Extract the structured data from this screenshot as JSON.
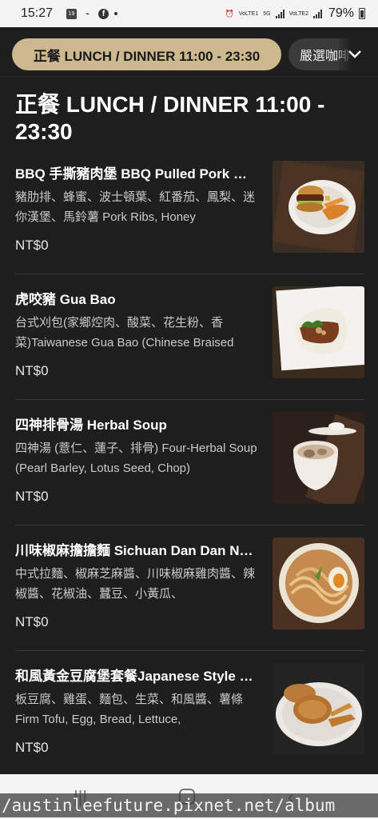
{
  "status_bar": {
    "time": "15:27",
    "battery": "79%",
    "net1": "VoLTE1",
    "net2": "VoLTE2",
    "five_g": "5G"
  },
  "tabs": {
    "active": "正餐 LUNCH / DINNER 11:00 - 23:30",
    "next": "嚴選咖啡"
  },
  "section_title": "正餐 LUNCH / DINNER 11:00 - 23:30",
  "items": [
    {
      "name": "BBQ 手撕豬肉堡 BBQ Pulled Pork Burger",
      "desc": "豬肋排、蜂蜜、波士頓葉、紅番茄、鳳梨、迷你漢堡、馬鈴薯 Pork Ribs, Honey",
      "price": "NT$0"
    },
    {
      "name": "虎咬豬 Gua Bao",
      "desc": "台式刈包(家鄉焢肉、酸菜、花生粉、香菜)Taiwanese Gua Bao (Chinese Braised",
      "price": "NT$0"
    },
    {
      "name": "四神排骨湯 Herbal Soup",
      "desc": "四神湯 (薏仁、蓮子、排骨) Four-Herbal Soup (Pearl Barley, Lotus Seed, Chop)",
      "price": "NT$0"
    },
    {
      "name": "川味椒麻擔擔麵 Sichuan Dan Dan Noodles",
      "desc": "中式拉麵、椒麻芝麻醬、川味椒麻雞肉醬、辣椒醬、花椒油、蠶豆、小黃瓜、",
      "price": "NT$0"
    },
    {
      "name": "和風黃金豆腐堡套餐Japanese Style Tofu Burger",
      "desc": "板豆腐、雞蛋、麵包、生菜、和風醬、薯條 Firm Tofu, Egg, Bread, Lettuce,",
      "price": "NT$0"
    }
  ],
  "watermark": "/austinleefuture.pixnet.net/album"
}
